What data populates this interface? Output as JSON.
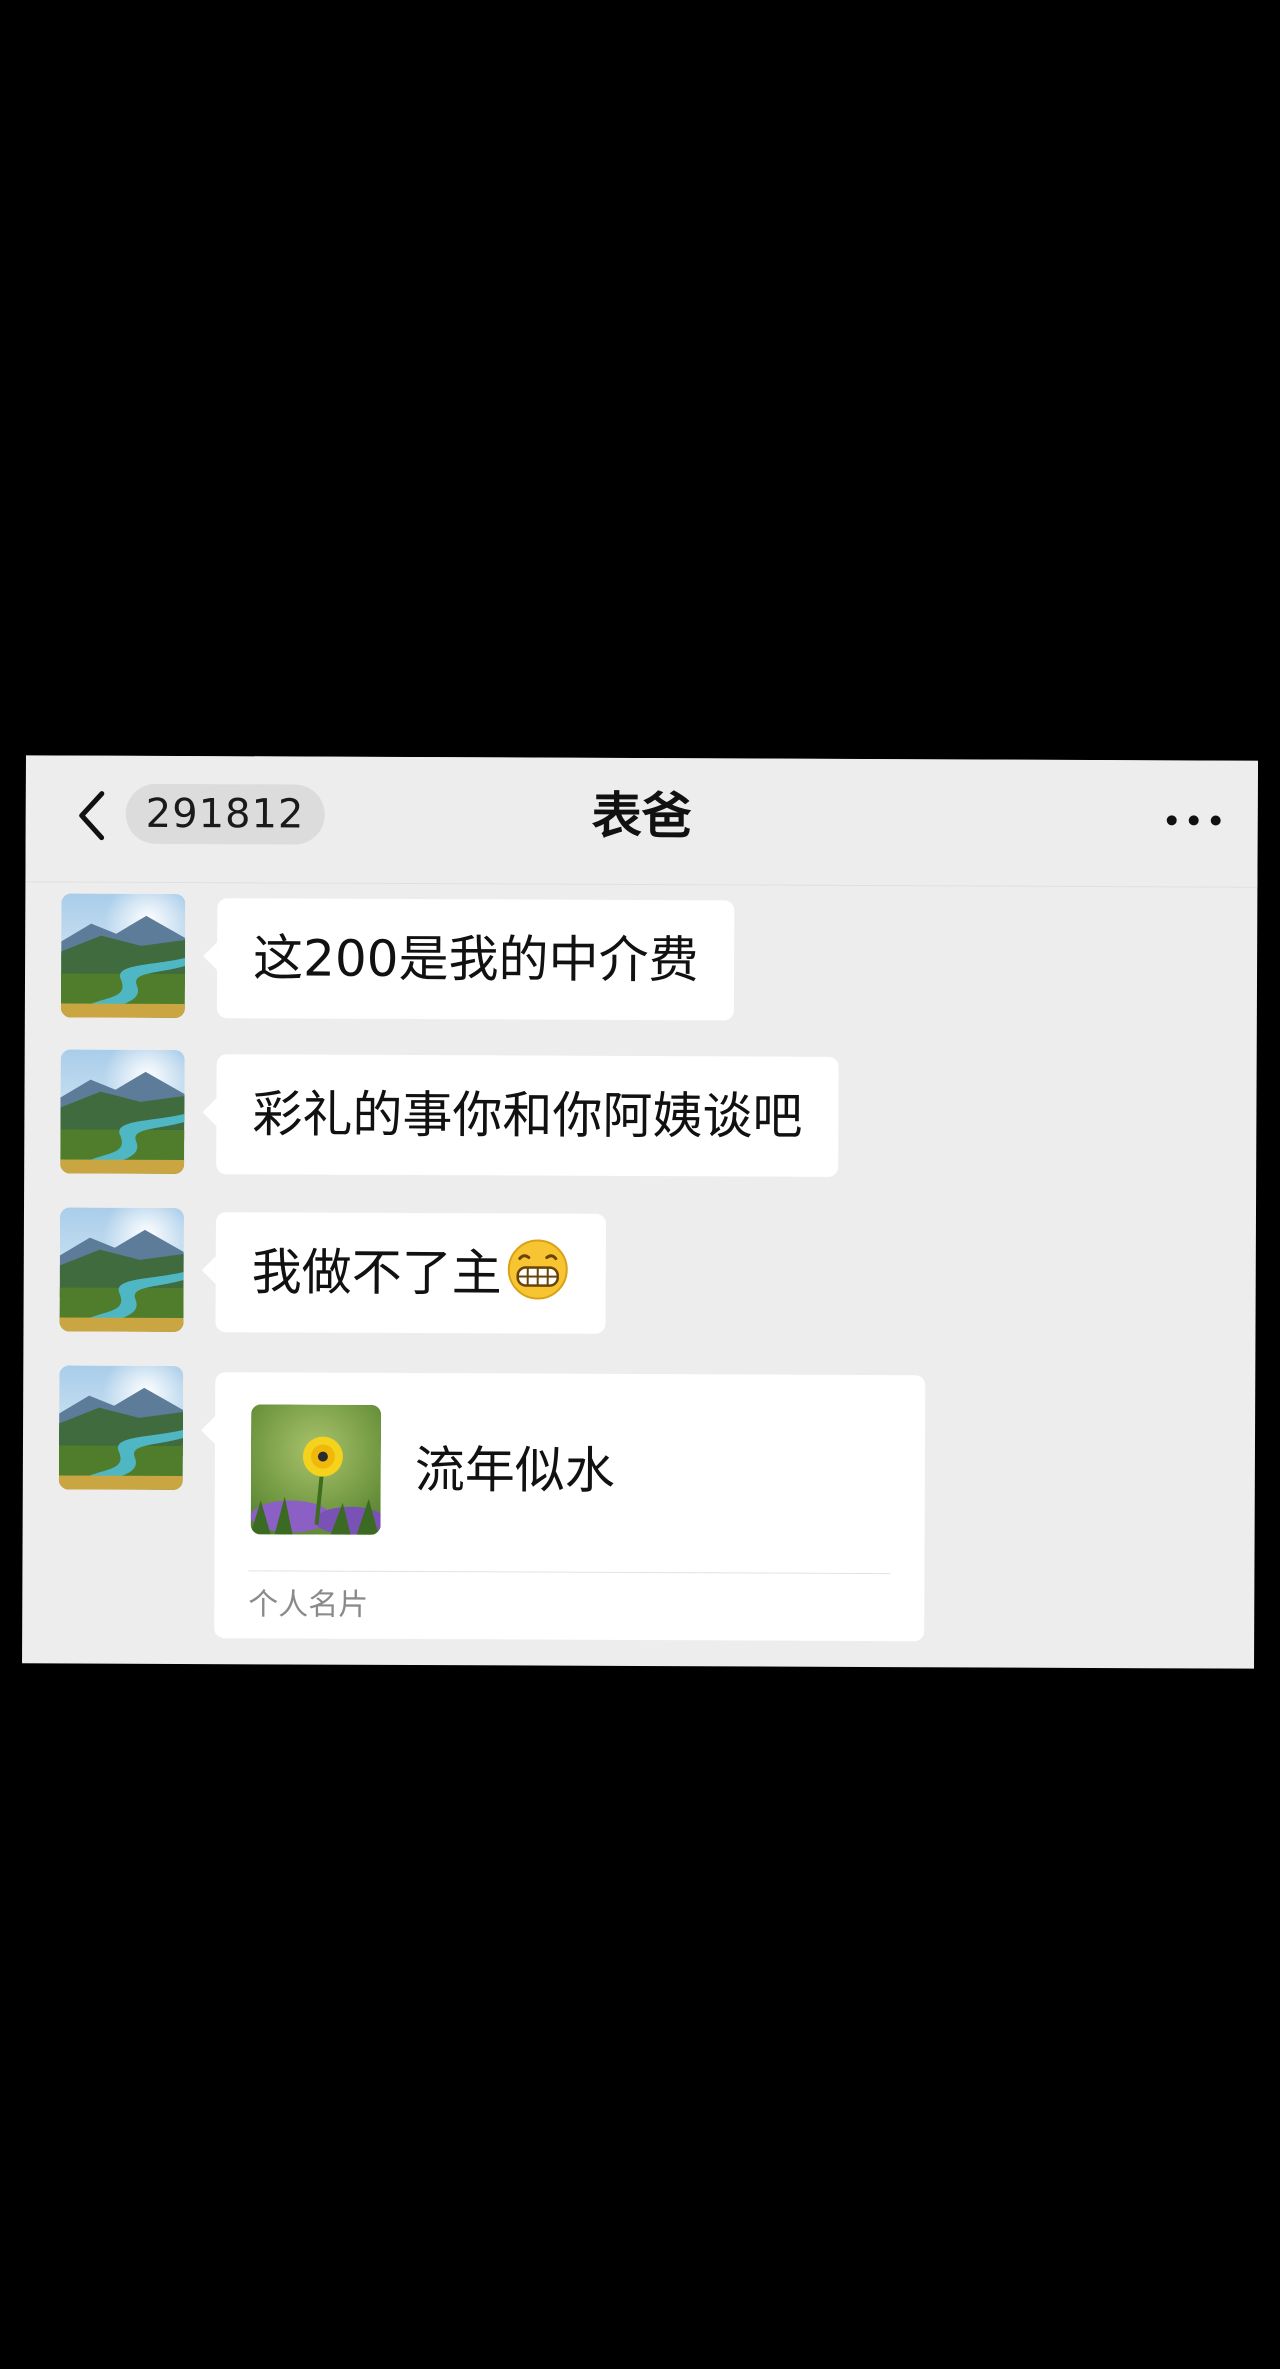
{
  "header": {
    "unread_count": "291812",
    "title": "表爸",
    "back_icon": "chevron-left-icon",
    "more_icon": "more-dots-icon"
  },
  "messages": [
    {
      "text": "这200是我的中介费"
    },
    {
      "text": "彩礼的事你和你阿姨谈吧"
    },
    {
      "text": "我做不了主",
      "emoji": "grinning-face-icon"
    }
  ],
  "contact_card": {
    "name": "流年似水",
    "label": "个人名片",
    "avatar_icon": "dandelion-photo"
  },
  "colors": {
    "page_background": "#000000",
    "chat_background": "#ededed",
    "bubble": "#ffffff",
    "badge": "#dcdcdc",
    "secondary_text": "#8a8a8a"
  }
}
